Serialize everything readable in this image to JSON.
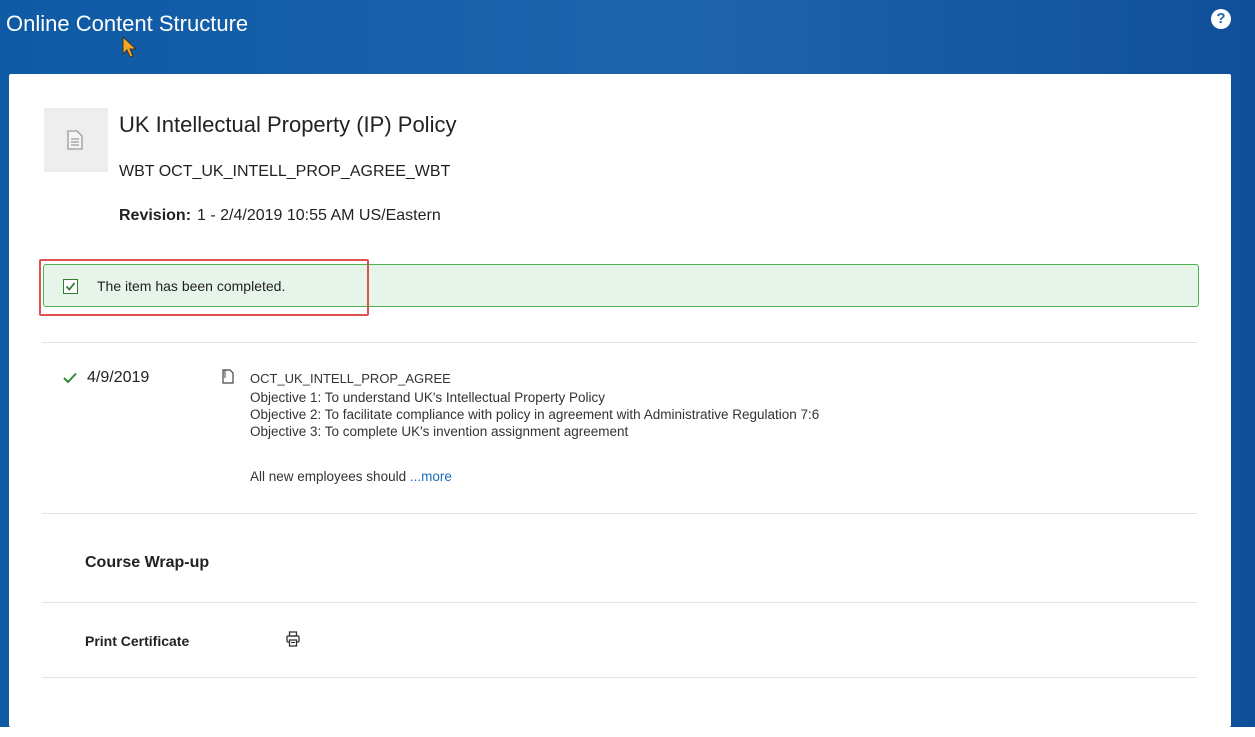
{
  "window": {
    "title": "Online Content Structure",
    "help_icon": "help-circle-icon",
    "help_glyph": "?"
  },
  "course": {
    "title": "UK Intellectual Property (IP) Policy",
    "code": "WBT OCT_UK_INTELL_PROP_AGREE_WBT",
    "revision_label": "Revision:",
    "revision_value": "1 - 2/4/2019 10:55 AM US/Eastern",
    "thumbnail_icon": "document-icon"
  },
  "status": {
    "text": "The item has been completed.",
    "checked": true,
    "icon": "checkbox-checked-icon"
  },
  "item": {
    "check_icon": "checkmark-icon",
    "date": "4/9/2019",
    "doc_icon": "document-outline-icon",
    "code": "OCT_UK_INTELL_PROP_AGREE",
    "objectives": [
      "Objective 1: To understand UK's Intellectual Property Policy",
      "Objective 2: To facilitate compliance with policy in agreement with Administrative Regulation 7:6",
      "Objective 3: To complete UK's invention assignment agreement"
    ],
    "summary_prefix": "All new employees should",
    "more_link": "...more"
  },
  "wrapup": {
    "section_title": "Course Wrap-up",
    "certificate_label": "Print Certificate",
    "print_icon": "printer-icon"
  },
  "colors": {
    "header_blue": "#1e64ad",
    "status_green_bg": "#e6f4ea",
    "status_green_border": "#4caf50",
    "highlight_red": "#e05252",
    "link_blue": "#1b6ec2",
    "check_green": "#2e7d32"
  }
}
